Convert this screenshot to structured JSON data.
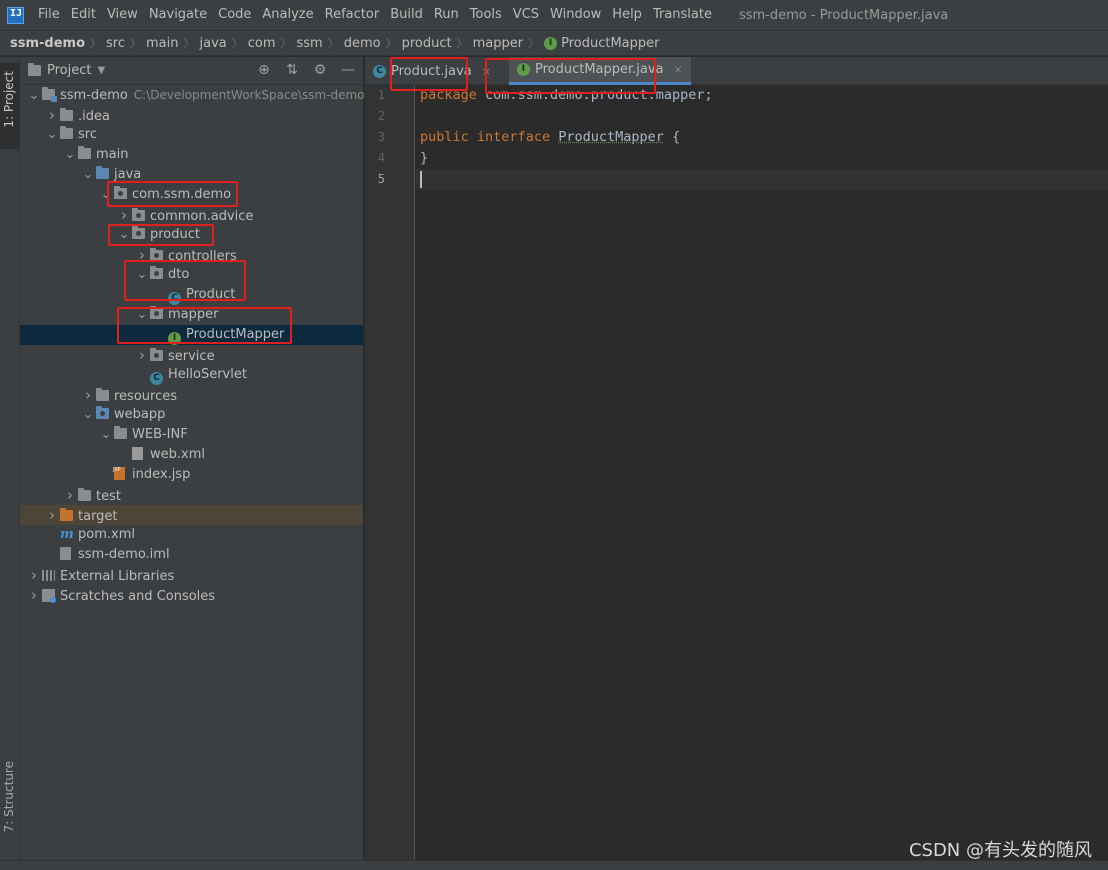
{
  "menubar": {
    "items": [
      "File",
      "Edit",
      "View",
      "Navigate",
      "Code",
      "Analyze",
      "Refactor",
      "Build",
      "Run",
      "Tools",
      "VCS",
      "Window",
      "Help",
      "Translate"
    ],
    "window_title": "ssm-demo - ProductMapper.java"
  },
  "breadcrumb": {
    "items": [
      "ssm-demo",
      "src",
      "main",
      "java",
      "com",
      "ssm",
      "demo",
      "product",
      "mapper"
    ],
    "current": "ProductMapper"
  },
  "tool_strip": {
    "project_label": "1: Project",
    "structure_label": "7: Structure"
  },
  "project_panel": {
    "title": "Project",
    "tree": [
      {
        "label": "ssm-demo",
        "path": "C:\\DevelopmentWorkSpace\\ssm-demo",
        "depth": 0,
        "expanded": true,
        "icon": "module-folder-icon"
      },
      {
        "label": ".idea",
        "depth": 1,
        "expanded": false,
        "icon": "folder-icon"
      },
      {
        "label": "src",
        "depth": 1,
        "expanded": true,
        "icon": "folder-icon"
      },
      {
        "label": "main",
        "depth": 2,
        "expanded": true,
        "icon": "folder-icon"
      },
      {
        "label": "java",
        "depth": 3,
        "expanded": true,
        "icon": "source-folder-icon"
      },
      {
        "label": "com.ssm.demo",
        "depth": 4,
        "expanded": true,
        "icon": "package-icon"
      },
      {
        "label": "common.advice",
        "depth": 5,
        "expanded": false,
        "icon": "package-icon"
      },
      {
        "label": "product",
        "depth": 5,
        "expanded": true,
        "icon": "package-icon"
      },
      {
        "label": "controllers",
        "depth": 6,
        "expanded": false,
        "icon": "package-icon"
      },
      {
        "label": "dto",
        "depth": 6,
        "expanded": true,
        "icon": "package-icon"
      },
      {
        "label": "Product",
        "depth": 7,
        "leaf": true,
        "icon": "class-icon"
      },
      {
        "label": "mapper",
        "depth": 6,
        "expanded": true,
        "icon": "package-icon"
      },
      {
        "label": "ProductMapper",
        "depth": 7,
        "leaf": true,
        "icon": "interface-icon",
        "selected": true
      },
      {
        "label": "service",
        "depth": 6,
        "expanded": false,
        "icon": "package-icon"
      },
      {
        "label": "HelloServlet",
        "depth": 6,
        "leaf": true,
        "icon": "class-icon"
      },
      {
        "label": "resources",
        "depth": 3,
        "expanded": false,
        "icon": "resources-folder-icon"
      },
      {
        "label": "webapp",
        "depth": 3,
        "expanded": true,
        "icon": "web-folder-icon"
      },
      {
        "label": "WEB-INF",
        "depth": 4,
        "expanded": true,
        "icon": "folder-icon"
      },
      {
        "label": "web.xml",
        "depth": 5,
        "leaf": true,
        "icon": "xml-file-icon"
      },
      {
        "label": "index.jsp",
        "depth": 4,
        "leaf": true,
        "icon": "jsp-file-icon"
      },
      {
        "label": "test",
        "depth": 2,
        "expanded": false,
        "icon": "folder-icon"
      },
      {
        "label": "target",
        "depth": 1,
        "expanded": false,
        "icon": "excluded-folder-icon",
        "excluded": true
      },
      {
        "label": "pom.xml",
        "depth": 1,
        "leaf": true,
        "icon": "maven-icon"
      },
      {
        "label": "ssm-demo.iml",
        "depth": 1,
        "leaf": true,
        "icon": "iml-file-icon"
      },
      {
        "label": "External Libraries",
        "depth": 0,
        "expanded": false,
        "icon": "libraries-icon"
      },
      {
        "label": "Scratches and Consoles",
        "depth": 0,
        "expanded": false,
        "icon": "scratches-icon"
      }
    ]
  },
  "tabs": [
    {
      "label": "Product.java",
      "icon": "class-icon",
      "active": false
    },
    {
      "label": "ProductMapper.java",
      "icon": "interface-icon",
      "active": true
    }
  ],
  "editor": {
    "line_numbers": [
      "1",
      "2",
      "3",
      "4",
      "5"
    ],
    "line1": {
      "kw": "package",
      "rest": " com.ssm.demo.product.mapper;"
    },
    "line3": {
      "kw1": "public",
      "kw2": "interface",
      "name": "ProductMapper",
      "rest": " {"
    },
    "line4": "}"
  },
  "watermark": "CSDN @有头发的随风",
  "colors": {
    "highlight": "#e0201c",
    "accent": "#4a88c7",
    "keyword": "#cc7832"
  }
}
